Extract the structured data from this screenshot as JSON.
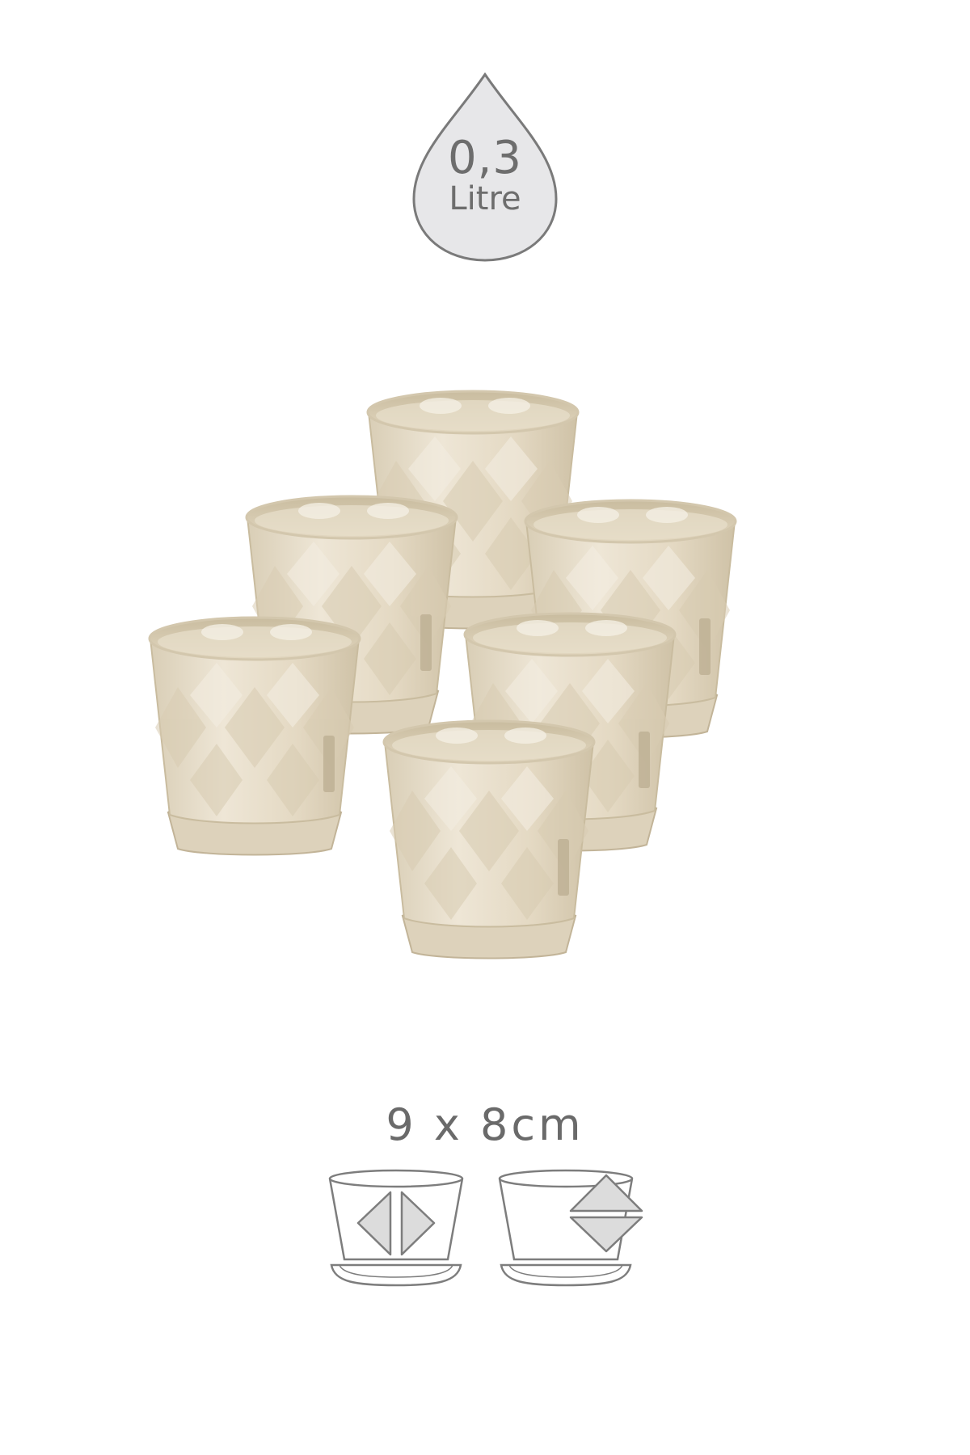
{
  "capacity": {
    "value": "0,3",
    "unit": "Litre"
  },
  "product": {
    "pot_count": 6,
    "pot_color": "#e6dcc8",
    "shadow_color": "#c4b89f",
    "highlight_color": "#f6f1e7"
  },
  "dimensions": {
    "text": "9 x 8cm"
  },
  "icons": {
    "width_icon": "pot-width-diagram-icon",
    "height_icon": "pot-height-diagram-icon"
  },
  "colors": {
    "badge_fill": "#e7e7e9",
    "badge_stroke": "#7a7a7a",
    "icon_stroke": "#7d7d7d",
    "icon_fill": "#dcdcdc"
  }
}
